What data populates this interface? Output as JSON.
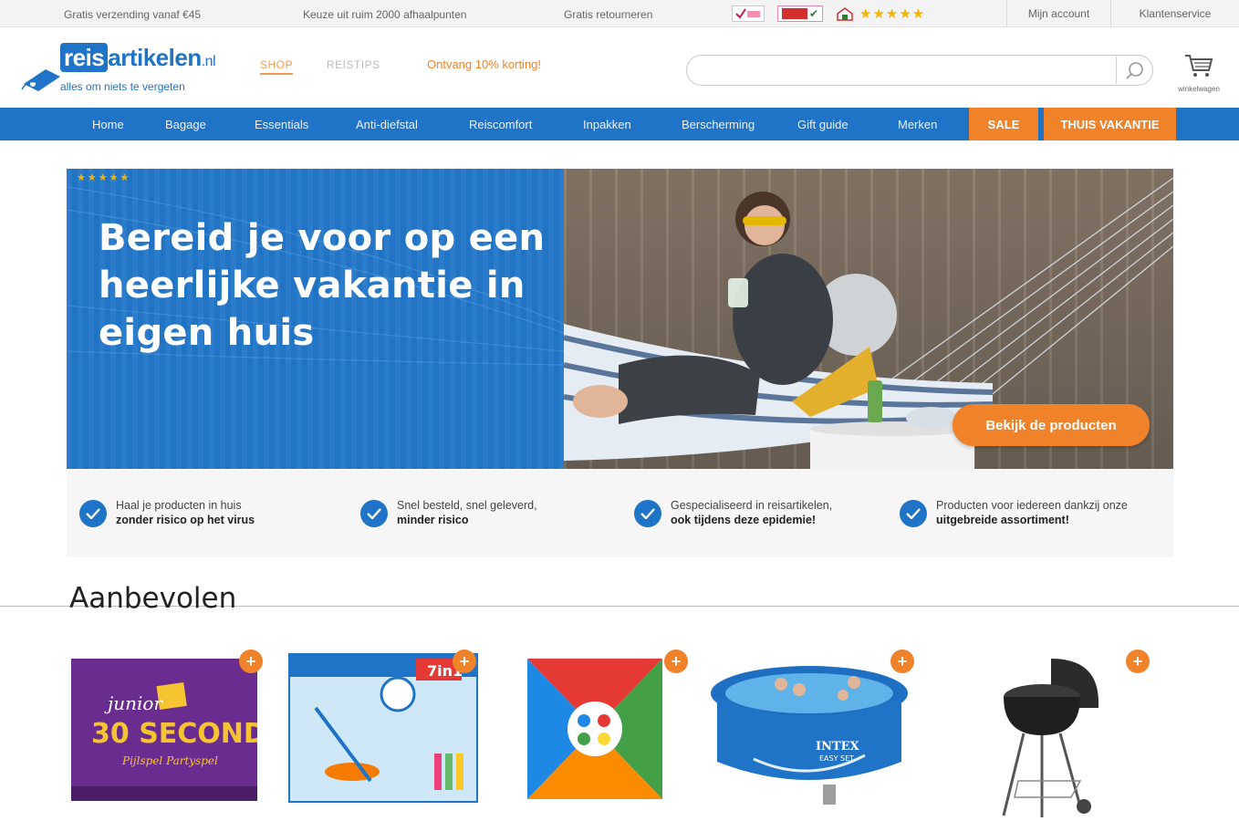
{
  "topbar": {
    "usps": [
      "Gratis verzending vanaf €45",
      "Keuze uit ruim 2000 afhaalpunten",
      "Gratis retourneren"
    ],
    "rating_stars": "★★★★★",
    "links": [
      "Mijn account",
      "Klantenservice"
    ]
  },
  "header": {
    "logo": {
      "reis": "reis",
      "artikelen": "artikelen",
      "tld": ".nl",
      "tagline": "alles om niets te vergeten"
    },
    "nav": [
      "SHOP",
      "REISTIPS"
    ],
    "promo": "Ontvang 10% korting!",
    "search": {
      "placeholder": "",
      "value": ""
    },
    "cart_label": "winkelwagen"
  },
  "mainnav": {
    "items": [
      "Home",
      "Bagage",
      "Essentials",
      "Anti-diefstal",
      "Reiscomfort",
      "Inpakken",
      "Berscherming",
      "Gift guide",
      "Merken"
    ],
    "sale": "SALE",
    "thuis": "THUIS VAKANTIE"
  },
  "hero": {
    "headline": "Bereid je voor op een heerlijke vakantie in eigen huis",
    "cta": "Bekijk de producten"
  },
  "usps": [
    {
      "line1": "Haal je producten in huis",
      "line2": "zonder risico op het virus"
    },
    {
      "line1": "Snel besteld, snel geleverd,",
      "line2": "minder risico"
    },
    {
      "line1": "Gespecialiseerd in reisartikelen,",
      "line2": "ook tijdens deze epidemie!"
    },
    {
      "line1": "Producten voor iedereen dankzij  onze",
      "line2": "uitgebreide assortiment!"
    }
  ],
  "section": {
    "title": "Aanbevolen"
  },
  "products": [
    {
      "name": "Junior 30 Seconds",
      "box_text_1": "junior",
      "box_text_2": "30 SECONDS",
      "box_text_3": "Pijlspel Partyspel"
    },
    {
      "name": "7-in-1 outdoor spel",
      "box_text_1": "7in1"
    },
    {
      "name": "Twister-achtig spel",
      "box_text_1": ""
    },
    {
      "name": "Intex Easy Set zwembad",
      "box_text_1": "INTEX",
      "box_text_2": "EASY SET"
    },
    {
      "name": "Houtskoolbarbecue",
      "box_text_1": ""
    }
  ],
  "colors": {
    "primary": "#1f74c8",
    "accent": "#f0822a"
  }
}
